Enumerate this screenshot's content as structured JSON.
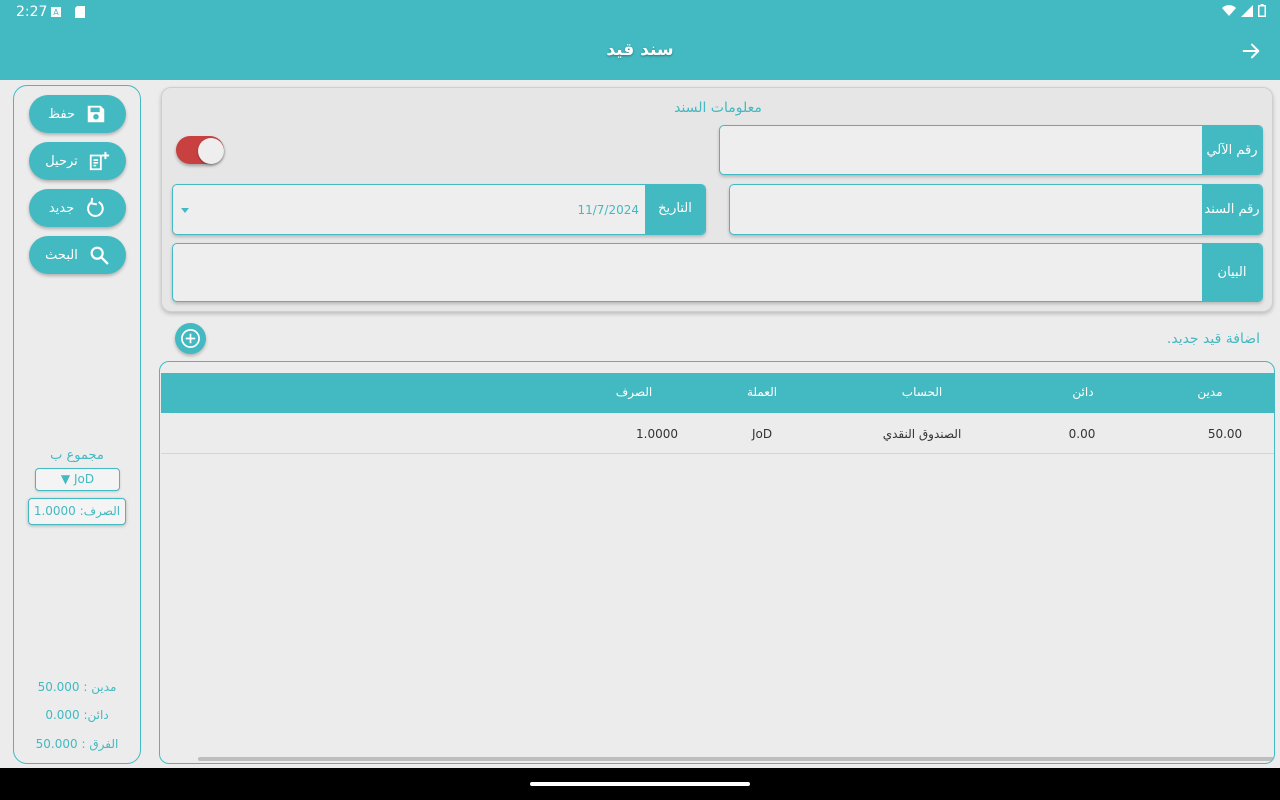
{
  "status_bar": {
    "time": "2:27"
  },
  "app_bar": {
    "title": "سند قيد"
  },
  "sidebar": {
    "buttons": [
      {
        "label": "حفظ",
        "icon": "save-icon"
      },
      {
        "label": "ترحيل",
        "icon": "post-note-icon"
      },
      {
        "label": "جديد",
        "icon": "refresh-icon"
      },
      {
        "label": "البحث",
        "icon": "search-icon"
      }
    ],
    "sum_label": "مجموع ب",
    "currency": "▼ JoD",
    "rate": "الصرف: 1.0000",
    "totals": {
      "debit": "مدين : 50.000",
      "credit": "دائن: 0.000",
      "difference": "الفرق : 50.000"
    }
  },
  "info_card": {
    "title": "معلومات السند",
    "auto_number": {
      "label": "رقم الآلي",
      "value": ""
    },
    "voucher_number": {
      "label": "رقم السند",
      "value": ""
    },
    "date": {
      "label": "التاريخ",
      "value": "11/7/2024"
    },
    "description": {
      "label": "البيان",
      "value": ""
    },
    "toggle_on": true
  },
  "add_entry_label": "اضافة قيد جديد.",
  "table": {
    "headers": [
      "مدين",
      "دائن",
      "الحساب",
      "العملة",
      "الصرف"
    ],
    "rows": [
      [
        "50.00",
        "0.00",
        "الصندوق النقدي",
        "JoD",
        "1.0000"
      ]
    ]
  },
  "colors": {
    "primary": "#43b9c1",
    "toggle": "#c8403f",
    "background": "#ececec"
  }
}
